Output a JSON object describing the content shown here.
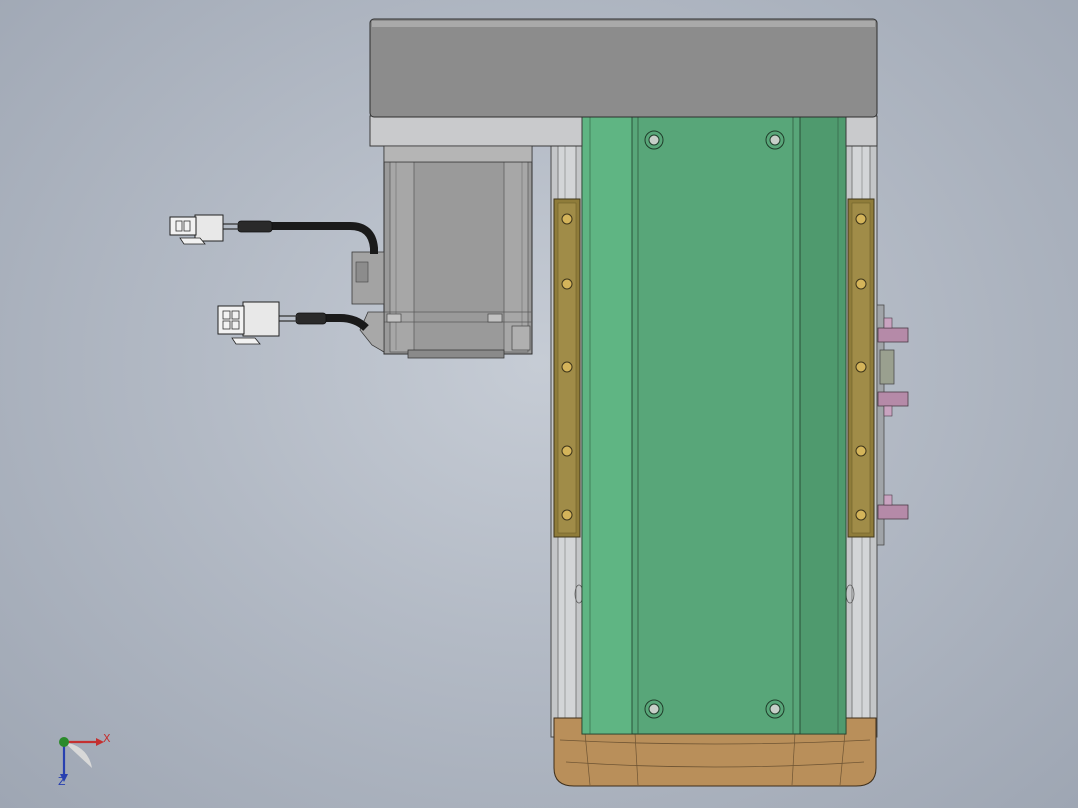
{
  "view": {
    "background_color": "#b3bac5"
  },
  "model": {
    "carriage_color": "#58a679",
    "rail_color": "#8f7c3a",
    "end_cap_color": "#b98f5a",
    "motor_color": "#9a9a9a",
    "top_block_color": "#8c8c8c",
    "bracket_color": "#b58aa8"
  },
  "triad": {
    "x_label": "X",
    "z_label": "Z",
    "y_label": "",
    "x_color": "#c43030",
    "y_color": "#2a8a2a",
    "z_color": "#2840b0"
  }
}
